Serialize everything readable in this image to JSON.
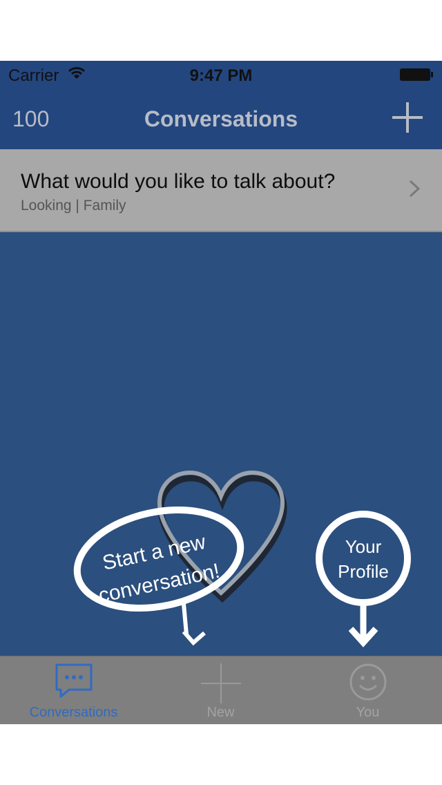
{
  "status_bar": {
    "carrier": "Carrier",
    "time": "9:47 PM"
  },
  "nav": {
    "count": "100",
    "title": "Conversations"
  },
  "conversation": {
    "title": "What would you like to talk about?",
    "subtitle": "Looking | Family"
  },
  "hints": {
    "new_line1": "Start a new",
    "new_line2": "conversation!",
    "profile_line1": "Your",
    "profile_line2": "Profile"
  },
  "tabs": [
    {
      "label": "Conversations",
      "icon": "chat-bubble-icon",
      "selected": true
    },
    {
      "label": "New",
      "icon": "plus-icon",
      "selected": false
    },
    {
      "label": "You",
      "icon": "smiley-icon",
      "selected": false
    }
  ],
  "colors": {
    "nav": "#23467f",
    "background": "#2b4f7e",
    "accent": "#2f6bc4",
    "tab_bar": "#7f7f7f"
  }
}
